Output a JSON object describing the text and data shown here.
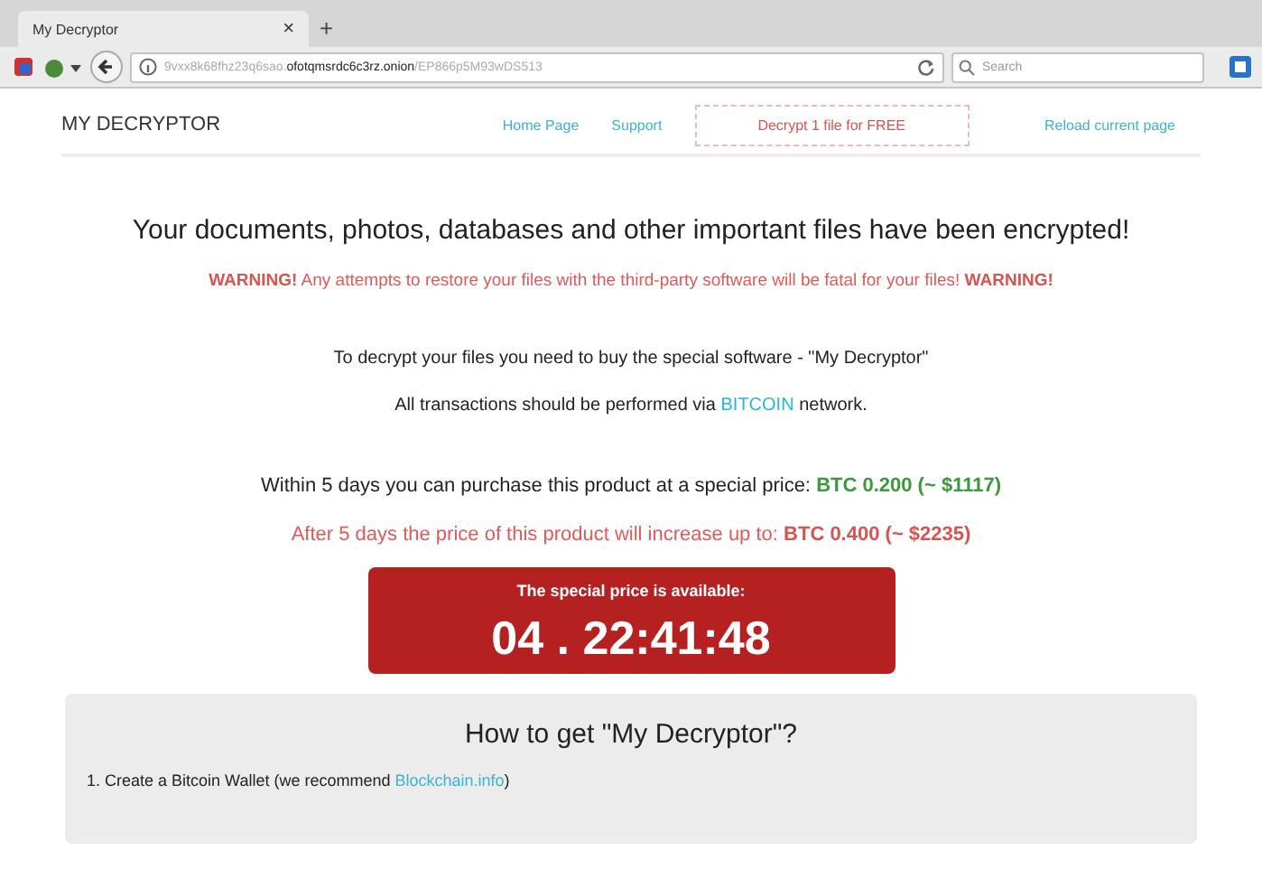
{
  "browser": {
    "tab_title": "My Decryptor",
    "new_tab": "+",
    "close": "×",
    "url": {
      "subdomain": "9vxx8k68fhz23q6sao.",
      "host": "ofotqmsrdc6c3rz.onion",
      "path": "/EP866p5M93wDS513"
    },
    "search_placeholder": "Search"
  },
  "nav": {
    "brand": "MY DECRYPTOR",
    "links": [
      {
        "label": "Home Page",
        "kind": "link"
      },
      {
        "label": "Support",
        "kind": "link"
      },
      {
        "label": "Decrypt 1 file for FREE",
        "kind": "button"
      },
      {
        "label": "Reload current page",
        "kind": "link"
      }
    ]
  },
  "headline": "Your documents, photos, databases and other important files have been encrypted!",
  "messages": [
    {
      "kind": "warning",
      "segments": [
        {
          "text": "WARNING!",
          "kind": "emphasis"
        },
        {
          "text": " Any attempts to restore your files with the third-party software will be fatal for your files! ",
          "kind": "normal"
        },
        {
          "text": "WARNING!",
          "kind": "emphasis"
        }
      ]
    },
    {
      "kind": "info",
      "segments": [
        {
          "text": "To decrypt your files you need to buy the special software - \"My Decryptor\"",
          "kind": "normal"
        }
      ]
    },
    {
      "kind": "info",
      "segments": [
        {
          "text": "All transactions should be performed via ",
          "kind": "normal"
        },
        {
          "text": "BITCOIN",
          "kind": "highlight"
        },
        {
          "text": " network.",
          "kind": "normal"
        }
      ]
    },
    {
      "kind": "price",
      "segments": [
        {
          "text": "Within 5 days you can purchase this product at a special price: ",
          "kind": "normal"
        },
        {
          "text": "BTC 0.200 (~ $1117)",
          "kind": "offer"
        }
      ]
    },
    {
      "kind": "warning",
      "segments": [
        {
          "text": "After 5 days the price of this product will increase up to: ",
          "kind": "normal"
        },
        {
          "text": "BTC 0.400 (~ $2235)",
          "kind": "emphasis"
        }
      ]
    }
  ],
  "timer": {
    "label": "The special price is available:",
    "time": "04 . 22:41:48"
  },
  "howto": {
    "title": "How to get \"My Decryptor\"?",
    "steps": [
      {
        "number": "1.",
        "text": "Create a Bitcoin Wallet (we recommend ",
        "link": "Blockchain.info",
        "after": ")"
      }
    ]
  }
}
